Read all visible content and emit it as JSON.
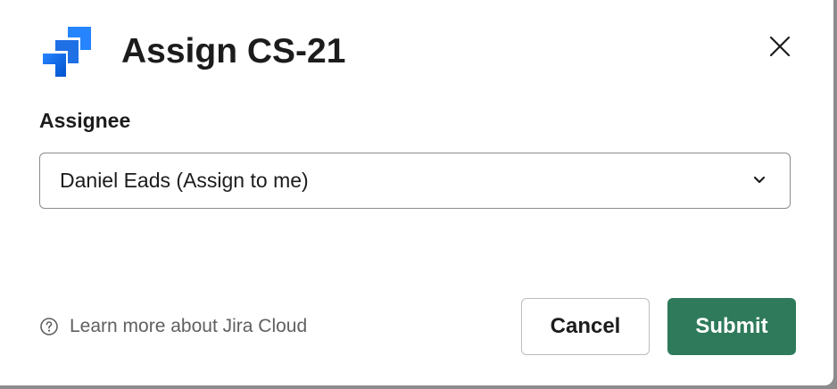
{
  "dialog": {
    "title": "Assign CS-21",
    "logo_icon": "jira-logo-icon",
    "close_icon": "close-icon"
  },
  "form": {
    "assignee_label": "Assignee",
    "assignee_value": "Daniel Eads (Assign to me)",
    "chevron_icon": "chevron-down-icon"
  },
  "footer": {
    "help_icon": "question-circle-icon",
    "learn_more_text": "Learn more about Jira Cloud",
    "cancel_label": "Cancel",
    "submit_label": "Submit"
  },
  "colors": {
    "submit_bg": "#2e7a5a",
    "jira_blue_dark": "#1868db",
    "jira_blue_light": "#4c9aff",
    "text_primary": "#1d1c1d",
    "text_secondary": "#616061"
  }
}
